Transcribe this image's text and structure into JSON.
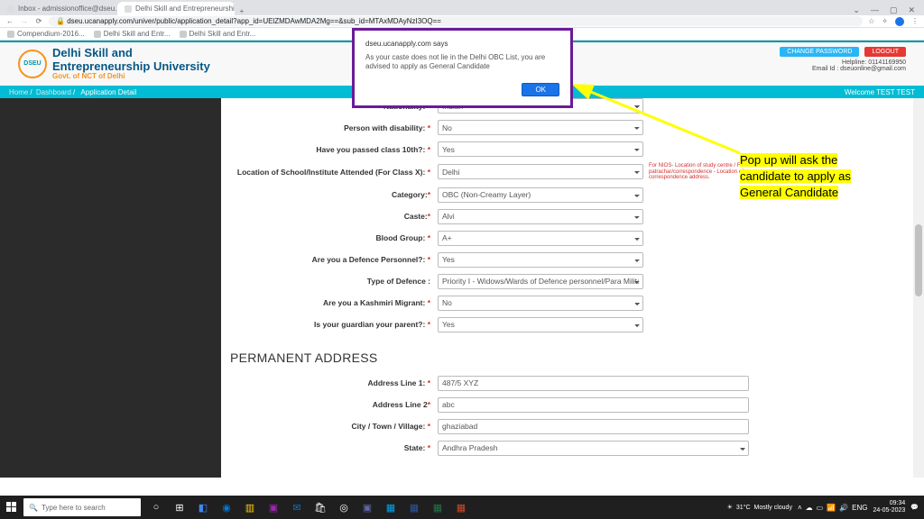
{
  "chrome": {
    "tabs": [
      {
        "title": "Inbox - admissionoffice@dseu..."
      },
      {
        "title": "Delhi Skill and Entrepreneurship"
      }
    ],
    "new_tab": "+",
    "win_min": "—",
    "win_max": "▢",
    "win_close": "✕",
    "nav_back": "←",
    "nav_fwd": "→",
    "nav_reload": "⟳",
    "lock": "🔒",
    "url": "dseu.ucanapply.com/univer/public/application_detail?app_id=UElZMDAwMDA2Mg==&sub_id=MTAxMDAyNzI3OQ==",
    "star": "☆",
    "ext": "✧",
    "menu": "⋮",
    "bookmarks": [
      {
        "label": "Compendium-2016..."
      },
      {
        "label": "Delhi Skill and Entr..."
      },
      {
        "label": "Delhi Skill and Entr..."
      }
    ]
  },
  "header": {
    "logo_abbr": "DSEU",
    "uni_line1": "Delhi Skill and",
    "uni_line2": "Entrepreneurship University",
    "uni_line3": "Govt. of NCT of Delhi",
    "btn_change_pw": "CHANGE PASSWORD",
    "btn_logout": "LOGOUT",
    "helpline": "Helpline: 01141169950",
    "email": "Email Id : dseuonline@gmail.com"
  },
  "breadcrumb": {
    "home": "Home",
    "dashboard": "Dashboard",
    "current": "Application Detail",
    "welcome": "Welcome TEST TEST"
  },
  "form": {
    "nationality": {
      "label": "Nationality:",
      "value": "Indian"
    },
    "pwd": {
      "label": "Person with disability:",
      "value": "No"
    },
    "class10": {
      "label": "Have you passed class 10th?:",
      "value": "Yes"
    },
    "schoolloc": {
      "label": "Location of School/Institute Attended (For Class X):",
      "value": "Delhi",
      "hint": "For NIOS- Location of study centre / For patrachar/correspondence - Location of correspondence address."
    },
    "category": {
      "label": "Category:",
      "value": "OBC (Non-Creamy Layer)"
    },
    "caste": {
      "label": "Caste:",
      "value": "Alvi"
    },
    "blood": {
      "label": "Blood Group:",
      "value": "A+"
    },
    "defence": {
      "label": "Are you a Defence Personnel?:",
      "value": "Yes"
    },
    "deftype": {
      "label": "Type of Defence :",
      "value": "Priority I - Widows/Wards of Defence personnel/Para Military"
    },
    "kashmiri": {
      "label": "Are you a Kashmiri Migrant:",
      "value": "No"
    },
    "guardian": {
      "label": "Is your guardian your parent?:",
      "value": "Yes"
    },
    "section_addr": "Permanent Address",
    "addr1": {
      "label": "Address Line 1:",
      "value": "487/5 XYZ"
    },
    "addr2": {
      "label": "Address Line 2",
      "value": "abc"
    },
    "city": {
      "label": "City / Town / Village:",
      "value": "ghaziabad"
    },
    "state": {
      "label": "State:",
      "value": "Andhra Pradesh"
    }
  },
  "alert": {
    "title": "dseu.ucanapply.com says",
    "msg": "As your caste does not lie in the Delhi OBC List, you are advised to apply as General Candidate",
    "ok": "OK"
  },
  "annotation": {
    "text": "Pop up will ask the candidate to apply as General Candidate"
  },
  "taskbar": {
    "search_placeholder": "Type here to search",
    "weather_temp": "31°C",
    "weather_txt": "Mostly cloudy",
    "lang": "ENG",
    "time": "09:34",
    "date": "24-05-2023"
  }
}
